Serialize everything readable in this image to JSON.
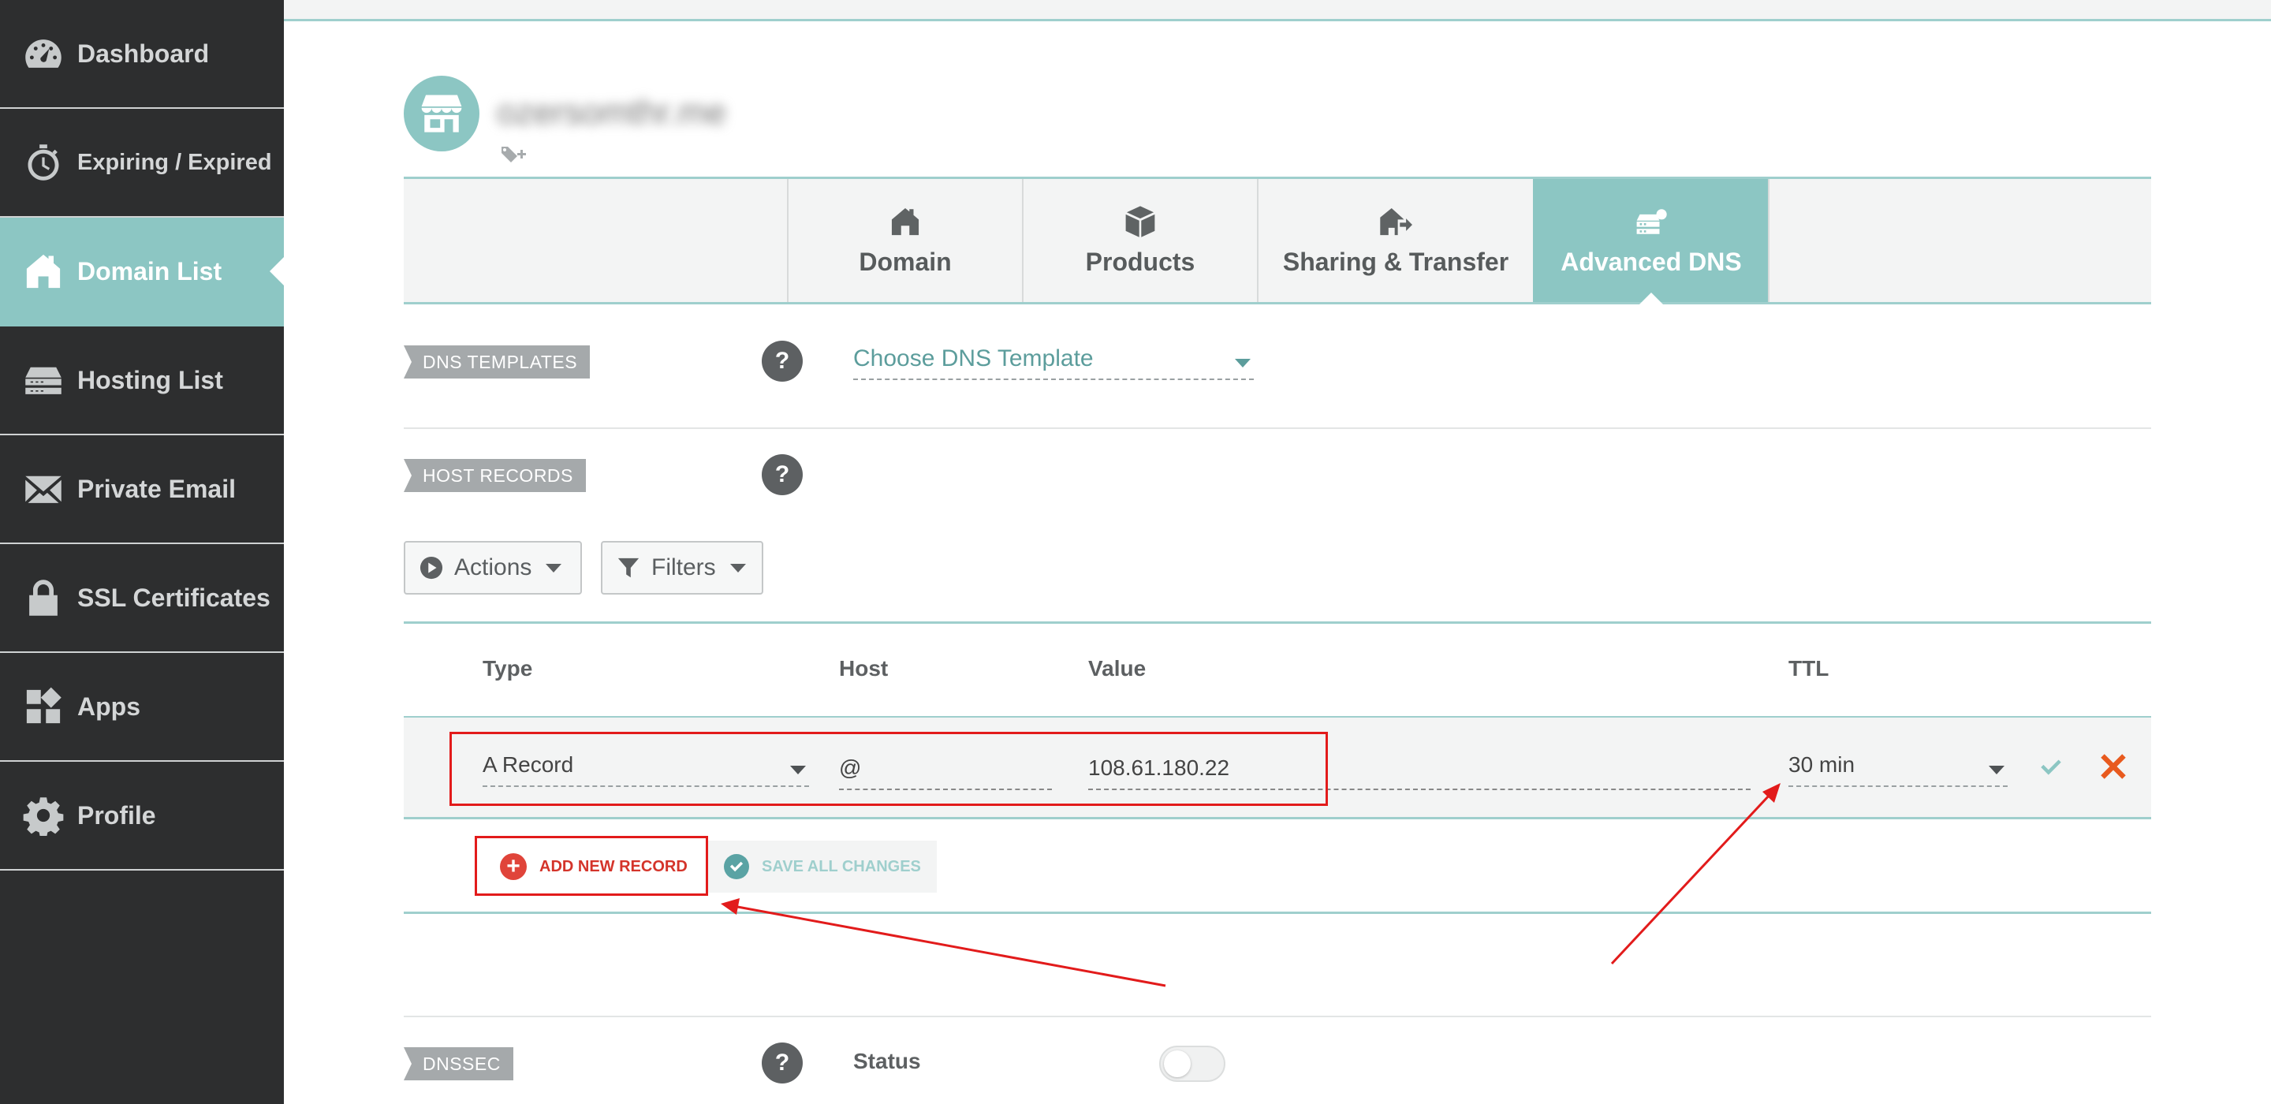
{
  "sidebar": {
    "items": [
      {
        "label": "Dashboard",
        "icon": "dashboard-gauge-icon"
      },
      {
        "label": "Expiring / Expired",
        "icon": "stopwatch-icon"
      },
      {
        "label": "Domain List",
        "icon": "home-icon",
        "active": true
      },
      {
        "label": "Hosting List",
        "icon": "server-icon"
      },
      {
        "label": "Private Email",
        "icon": "envelope-icon"
      },
      {
        "label": "SSL Certificates",
        "icon": "lock-icon"
      },
      {
        "label": "Apps",
        "icon": "apps-grid-icon"
      },
      {
        "label": "Profile",
        "icon": "gear-icon"
      }
    ]
  },
  "domain": {
    "name": "ozersomthr.me",
    "avatar_icon": "storefront-icon",
    "tag_icon": "tag-add-icon"
  },
  "tabs": [
    {
      "label": "Domain",
      "icon": "home-icon"
    },
    {
      "label": "Products",
      "icon": "box-icon"
    },
    {
      "label": "Sharing & Transfer",
      "icon": "share-transfer-icon"
    },
    {
      "label": "Advanced DNS",
      "icon": "dns-server-icon",
      "active": true
    }
  ],
  "dns_templates": {
    "label": "DNS TEMPLATES",
    "select_value": "Choose DNS Template"
  },
  "host_records": {
    "label": "HOST RECORDS",
    "actions_label": "Actions",
    "filters_label": "Filters",
    "columns": {
      "type": "Type",
      "host": "Host",
      "value": "Value",
      "ttl": "TTL"
    },
    "row": {
      "type": "A Record",
      "host": "@",
      "value": "108.61.180.22",
      "ttl": "30 min"
    },
    "add_new_label": "ADD NEW RECORD",
    "save_all_label": "SAVE ALL CHANGES"
  },
  "dnssec": {
    "label": "DNSSEC",
    "status_label": "Status",
    "enabled": false
  },
  "help_symbol": "?",
  "plus_symbol": "+",
  "colors": {
    "sidebar_bg": "#2d2e2f",
    "accent": "#8cc6c3",
    "annotation_red": "#e21b1b",
    "add_red": "#d4342a",
    "confirm_teal": "#5aa3a4",
    "cancel_orange": "#e85a1e"
  }
}
